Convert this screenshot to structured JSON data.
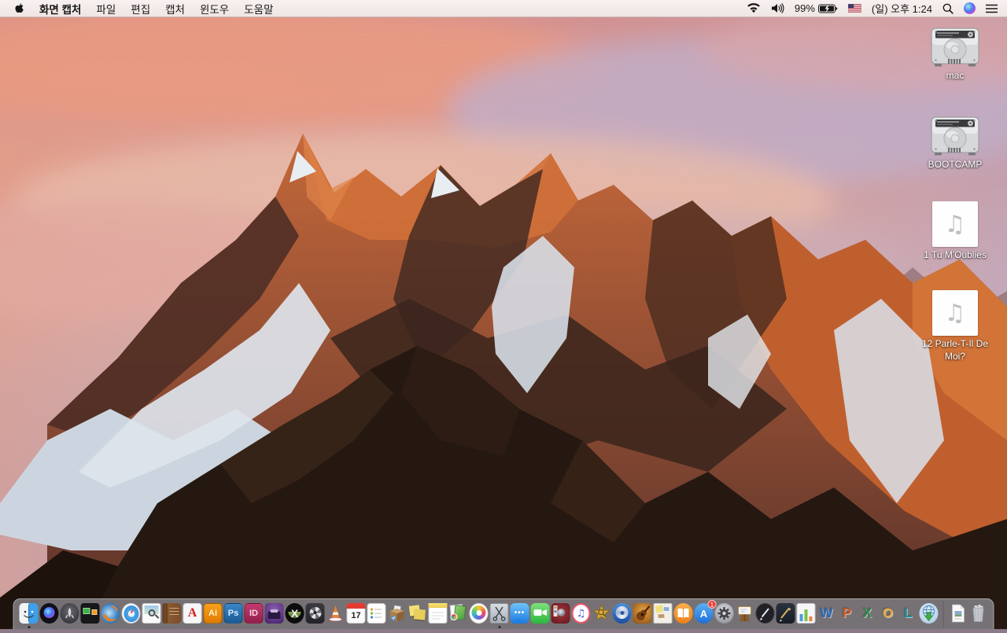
{
  "menu_bar": {
    "apple_logo": "apple-icon",
    "app_name": "화면 캡처",
    "menus": [
      "파일",
      "편집",
      "캡처",
      "윈도우",
      "도움말"
    ],
    "status": {
      "battery_percent": "99%",
      "battery_state": "charging",
      "clock": "(일) 오후 1:24",
      "icons": [
        "wifi-icon",
        "volume-icon",
        "battery-charging-icon",
        "input-source-us-flag",
        "spotlight-icon",
        "siri-icon",
        "notification-center-icon"
      ]
    }
  },
  "desktop": {
    "icons": [
      {
        "label": "mac",
        "type": "drive"
      },
      {
        "label": "BOOTCAMP",
        "type": "drive"
      },
      {
        "label": "1 Tu M'Oublies",
        "type": "audio"
      },
      {
        "label": "12 Parle-T-Il De Moi?",
        "type": "audio"
      }
    ]
  },
  "dock": {
    "items": [
      {
        "name": "finder",
        "running": true
      },
      {
        "name": "siri"
      },
      {
        "name": "launchpad"
      },
      {
        "name": "windows-app"
      },
      {
        "name": "firefox"
      },
      {
        "name": "safari"
      },
      {
        "name": "preview"
      },
      {
        "name": "contacts"
      },
      {
        "name": "acrobat"
      },
      {
        "name": "illustrator"
      },
      {
        "name": "photoshop"
      },
      {
        "name": "indesign"
      },
      {
        "name": "toast"
      },
      {
        "name": "x-circle-app"
      },
      {
        "name": "disk-tool"
      },
      {
        "name": "vlc"
      },
      {
        "name": "calendar",
        "day": "17"
      },
      {
        "name": "reminders"
      },
      {
        "name": "archive-box"
      },
      {
        "name": "stickies"
      },
      {
        "name": "notes"
      },
      {
        "name": "green-docs"
      },
      {
        "name": "photos"
      },
      {
        "name": "grab-screen-capture",
        "running": true
      },
      {
        "name": "messages"
      },
      {
        "name": "facetime"
      },
      {
        "name": "photobooth"
      },
      {
        "name": "itunes"
      },
      {
        "name": "star-app"
      },
      {
        "name": "blue-disc"
      },
      {
        "name": "garageband"
      },
      {
        "name": "paper-collage"
      },
      {
        "name": "ibooks"
      },
      {
        "name": "appstore",
        "badge": "1"
      },
      {
        "name": "sysprefs"
      },
      {
        "name": "keynote"
      },
      {
        "name": "pixelmator"
      },
      {
        "name": "pages"
      },
      {
        "name": "numbers"
      },
      {
        "name": "word",
        "letter": "W"
      },
      {
        "name": "powerpoint",
        "letter": "P"
      },
      {
        "name": "excel",
        "letter": "X"
      },
      {
        "name": "outlook",
        "letter": "O"
      },
      {
        "name": "lync",
        "letter": "L"
      },
      {
        "name": "download-globe"
      },
      {
        "name": "separator"
      },
      {
        "name": "document-file"
      },
      {
        "name": "trash",
        "full": true
      }
    ]
  },
  "colors": {
    "menubar_bg": "#f5efed",
    "dock_bg": "rgba(185,187,198,0.55)",
    "badge_red": "#e8413a",
    "label_text": "#ffffff",
    "sky_pink": "#e0998f",
    "sky_lavender": "#b7abc6",
    "rock_orange": "#c4683a",
    "rock_dark": "#241710",
    "snow": "#dde4ec"
  }
}
